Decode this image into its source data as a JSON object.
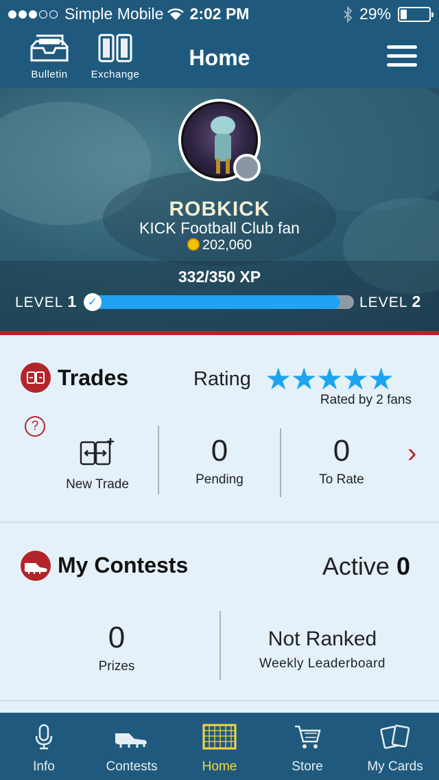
{
  "status_bar": {
    "carrier": "Simple Mobile",
    "time": "2:02 PM",
    "battery_percent": "29%",
    "battery_level": 0.29
  },
  "header": {
    "title": "Home",
    "bulletin_label": "Bulletin",
    "exchange_label": "Exchange"
  },
  "profile": {
    "username": "ROBKICK",
    "club": "KICK Football Club fan",
    "coins": "202,060",
    "xp_text": "332/350 XP",
    "xp_progress": 0.949,
    "level_current_label": "LEVEL",
    "level_current": "1",
    "level_next_label": "LEVEL",
    "level_next": "2"
  },
  "trades": {
    "title": "Trades",
    "rating_label": "Rating",
    "stars": 5,
    "rated_by": "Rated by 2 fans",
    "new_trade_label": "New Trade",
    "pending_value": "0",
    "pending_label": "Pending",
    "to_rate_value": "0",
    "to_rate_label": "To Rate"
  },
  "contests": {
    "title": "My Contests",
    "active_label": "Active",
    "active_value": "0",
    "prizes_value": "0",
    "prizes_label": "Prizes",
    "rank_value": "Not Ranked",
    "rank_label": "Weekly Leaderboard"
  },
  "tabbar": {
    "items": [
      {
        "label": "Info",
        "icon": "microphone-icon"
      },
      {
        "label": "Contests",
        "icon": "boot-icon"
      },
      {
        "label": "Home",
        "icon": "goal-icon"
      },
      {
        "label": "Store",
        "icon": "cart-icon"
      },
      {
        "label": "My Cards",
        "icon": "cards-icon"
      }
    ],
    "active_index": 2
  },
  "colors": {
    "header": "#1f5a7e",
    "accent_red": "#b3242a",
    "xp_blue": "#20a3f2",
    "tab_active": "#f6d53f",
    "background": "#e4f1f9"
  }
}
